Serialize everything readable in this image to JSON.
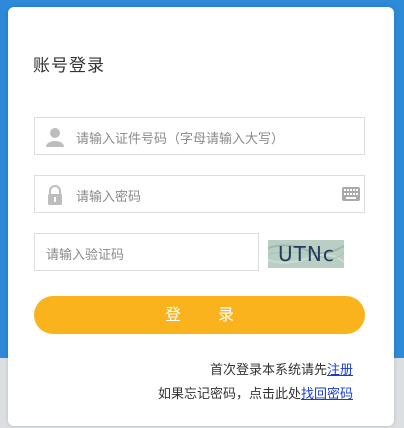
{
  "login": {
    "title": "账号登录",
    "username_placeholder": "请输入证件号码（字母请输入大写）",
    "password_placeholder": "请输入密码",
    "captcha_placeholder": "请输入验证码",
    "captcha_code": "UTNc",
    "submit_label": "登 录",
    "register_prompt": "首次登录本系统请先",
    "register_link": "注册",
    "forgot_prompt": "如果忘记密码，点击此处",
    "forgot_link": "找回密码"
  },
  "icons": {
    "username": "user-icon",
    "password": "lock-icon",
    "keyboard": "keyboard-icon"
  },
  "colors": {
    "background": "#2c8ad8",
    "button": "#fab21d",
    "link": "#1a3ccf"
  }
}
